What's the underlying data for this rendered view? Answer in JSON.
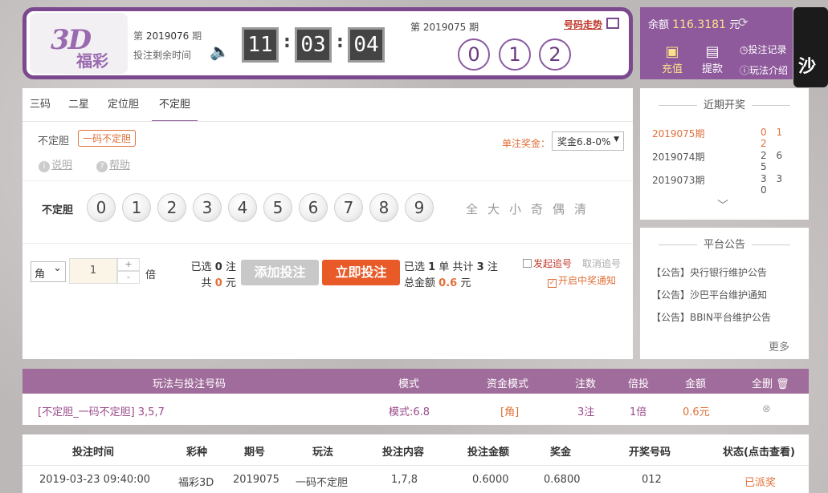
{
  "header": {
    "logo_main": "3D",
    "logo_sub": "福彩",
    "current_issue_prefix": "第",
    "current_issue": "2019076",
    "current_issue_suffix": "期",
    "remaining_label": "投注剩余时间",
    "countdown": [
      "11",
      "03",
      "04"
    ],
    "prev_issue_label": "第 2019075 期",
    "trend_link": "号码走势",
    "prev_draw": [
      "0",
      "1",
      "2"
    ]
  },
  "account": {
    "balance_label": "余额",
    "balance": "116.3181",
    "balance_unit": "元",
    "deposit": "充值",
    "withdraw": "提款",
    "bet_record": "投注记录",
    "play_intro": "玩法介绍",
    "promo_text": "沙"
  },
  "bet_panel": {
    "tabs": [
      "三码",
      "二星",
      "定位胆",
      "不定胆"
    ],
    "active_tab": "不定胆",
    "sub_type_label": "不定胆",
    "sub_type_active": "一码不定胆",
    "explain": "说明",
    "help": "帮助",
    "prize_label": "单注奖金：",
    "prize_select": "奖金6.8-0%",
    "digit_row_label": "不定胆",
    "digits": [
      "0",
      "1",
      "2",
      "3",
      "4",
      "5",
      "6",
      "7",
      "8",
      "9"
    ],
    "quick_select": [
      "全",
      "大",
      "小",
      "奇",
      "偶",
      "清"
    ],
    "unit": "角",
    "multiplier": "1",
    "multiplier_unit": "倍",
    "selected_prefix": "已选",
    "selected_count": "0",
    "selected_suffix": "注",
    "total_prefix": "共",
    "total_amount": "0",
    "total_suffix": "元",
    "add_bet": "添加投注",
    "bet_now": "立即投注",
    "order_selected_prefix": "已选",
    "order_selected": "1",
    "order_selected_mid": "单 共计",
    "order_count": "3",
    "order_count_suffix": "注",
    "order_total_prefix": "总金额",
    "order_total": "0.6",
    "order_total_suffix": "元",
    "chase": "发起追号",
    "cancel_chase": "取消追号",
    "notify": "开启中奖通知"
  },
  "recent_draws": {
    "title": "近期开奖",
    "rows": [
      {
        "issue": "2019075期",
        "nums": "0 1 2"
      },
      {
        "issue": "2019074期",
        "nums": "2 6 5"
      },
      {
        "issue": "2019073期",
        "nums": "3 3 0"
      }
    ]
  },
  "notices": {
    "title": "平台公告",
    "items": [
      "【公告】央行银行维护公告",
      "【公告】沙巴平台维护通知",
      "【公告】BBIN平台维护公告"
    ],
    "more": "更多"
  },
  "cart": {
    "headers": [
      "玩法与投注号码",
      "模式",
      "资金模式",
      "注数",
      "倍投",
      "金额",
      "全删"
    ],
    "row": {
      "play": "[不定胆_一码不定胆] 3,5,7",
      "mode": "模式:6.8",
      "fund_mode": "[角]",
      "count": "3注",
      "multiple": "1倍",
      "amount": "0.6元"
    }
  },
  "history": {
    "headers": [
      "投注时间",
      "彩种",
      "期号",
      "玩法",
      "投注内容",
      "投注金额",
      "奖金",
      "开奖号码",
      "状态(点击查看)"
    ],
    "row": [
      "2019-03-23 09:40:00",
      "福彩3D",
      "2019075",
      "一码不定胆",
      "1,7,8",
      "0.6000",
      "0.6800",
      "012",
      "已派奖"
    ]
  }
}
